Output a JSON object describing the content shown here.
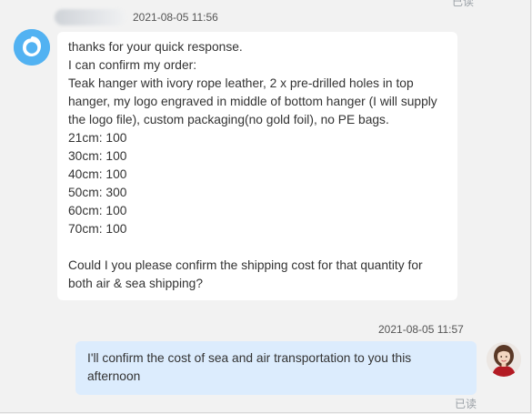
{
  "conversation": {
    "incoming": {
      "timestamp": "2021-08-05 11:56",
      "avatar_icon": "water-drop-avatar-icon",
      "avatar_color": "#52b2f2",
      "lines": [
        "thanks for your quick response.",
        "I can confirm my order:",
        "Teak hanger with ivory rope leather, 2 x pre-drilled holes in top",
        "hanger, my logo engraved in middle of bottom hanger (I will supply",
        "the logo file), custom packaging(no gold foil), no PE bags.",
        "21cm: 100",
        "30cm: 100",
        "40cm: 100",
        "50cm: 300",
        "60cm: 100",
        "70cm: 100",
        "",
        "Could I you please confirm the shipping cost for that quantity for",
        "both air & sea shipping?"
      ]
    },
    "outgoing": {
      "timestamp": "2021-08-05 11:57",
      "avatar_icon": "user-photo-avatar",
      "bubble_color": "#dcecfd",
      "lines": [
        "I'll confirm the cost of sea and air transportation to you this",
        "afternoon"
      ],
      "read_status": "已读"
    },
    "previous_read_status": "已读"
  }
}
